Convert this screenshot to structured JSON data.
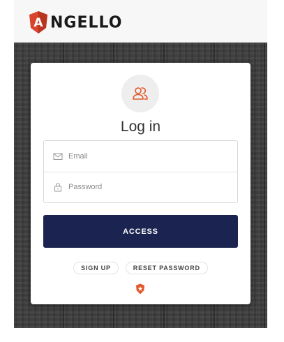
{
  "header": {
    "logo_text": "NGELLO",
    "logo_letter": "A"
  },
  "login": {
    "title": "Log in",
    "email_placeholder": "Email",
    "password_placeholder": "Password",
    "access_label": "ACCESS",
    "signup_label": "SIGN UP",
    "reset_label": "RESET PASSWORD",
    "avatar_icon": "users-icon",
    "badge_icon": "auth0-badge-icon"
  },
  "colors": {
    "accent": "#e2582a",
    "button": "#1b2350",
    "background_wood": "#3d3d3d"
  }
}
